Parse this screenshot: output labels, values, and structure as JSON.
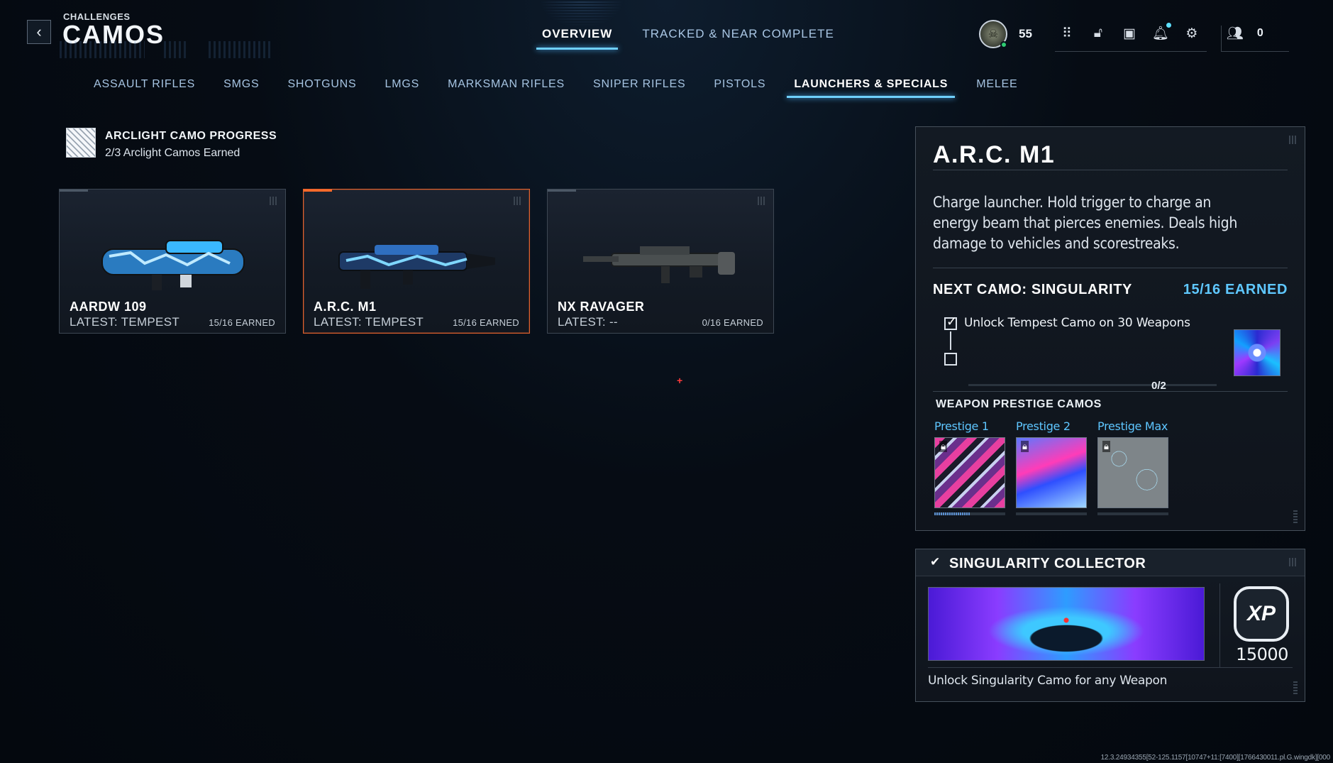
{
  "header": {
    "breadcrumb": "CHALLENGES",
    "title": "CAMOS",
    "tabs": [
      {
        "label": "OVERVIEW",
        "active": true
      },
      {
        "label": "TRACKED & NEAR COMPLETE",
        "active": false
      }
    ]
  },
  "hud": {
    "player_level": "55",
    "friends_count": "0",
    "icons": [
      "grid-menu-icon",
      "unlock-icon",
      "store-icon",
      "bell-icon",
      "gear-icon",
      "friends-icon"
    ]
  },
  "categories": [
    {
      "label": "ASSAULT RIFLES",
      "active": false
    },
    {
      "label": "SMGS",
      "active": false
    },
    {
      "label": "SHOTGUNS",
      "active": false
    },
    {
      "label": "LMGS",
      "active": false
    },
    {
      "label": "MARKSMAN RIFLES",
      "active": false
    },
    {
      "label": "SNIPER RIFLES",
      "active": false
    },
    {
      "label": "PISTOLS",
      "active": false
    },
    {
      "label": "LAUNCHERS & SPECIALS",
      "active": true
    },
    {
      "label": "MELEE",
      "active": false
    }
  ],
  "progress": {
    "title": "ARCLIGHT CAMO PROGRESS",
    "subtitle": "2/3 Arclight Camos Earned"
  },
  "weapons": [
    {
      "name": "AARDW 109",
      "latest": "LATEST: TEMPEST",
      "earned": "15/16 EARNED",
      "camo_color": "#3ab8ff"
    },
    {
      "name": "A.R.C. M1",
      "latest": "LATEST: TEMPEST",
      "earned": "15/16 EARNED",
      "camo_color": "#3ab8ff"
    },
    {
      "name": "NX RAVAGER",
      "latest": "LATEST: --",
      "earned": "0/16 EARNED",
      "camo_color": "#4a4f50"
    }
  ],
  "details": {
    "weapon_name": "A.R.C. M1",
    "description": "Charge launcher. Hold trigger to charge an energy beam that pierces enemies. Deals high damage to vehicles and scorestreaks.",
    "next_camo_label": "NEXT CAMO: SINGULARITY",
    "next_camo_earned": "15/16 EARNED",
    "tasks": [
      {
        "text": "Unlock Tempest Camo on 30 Weapons",
        "done": true
      },
      {
        "text": "",
        "done": false
      }
    ],
    "progress_count": "0/2",
    "prestige_title": "WEAPON PRESTIGE CAMOS",
    "prestige": [
      {
        "label": "Prestige 1",
        "locked": true,
        "progress": 0.5
      },
      {
        "label": "Prestige 2",
        "locked": true,
        "progress": 0
      },
      {
        "label": "Prestige Max",
        "locked": true,
        "progress": 0
      }
    ]
  },
  "collector": {
    "title": "SINGULARITY COLLECTOR",
    "xp_label": "XP",
    "xp_amount": "15000",
    "task": "Unlock Singularity Camo for any Weapon"
  },
  "red_marker": "+",
  "build_info": "12.3.24934355[52-125.1157[10747+11:[7400][1766430011.pl.G.wingdk][000"
}
